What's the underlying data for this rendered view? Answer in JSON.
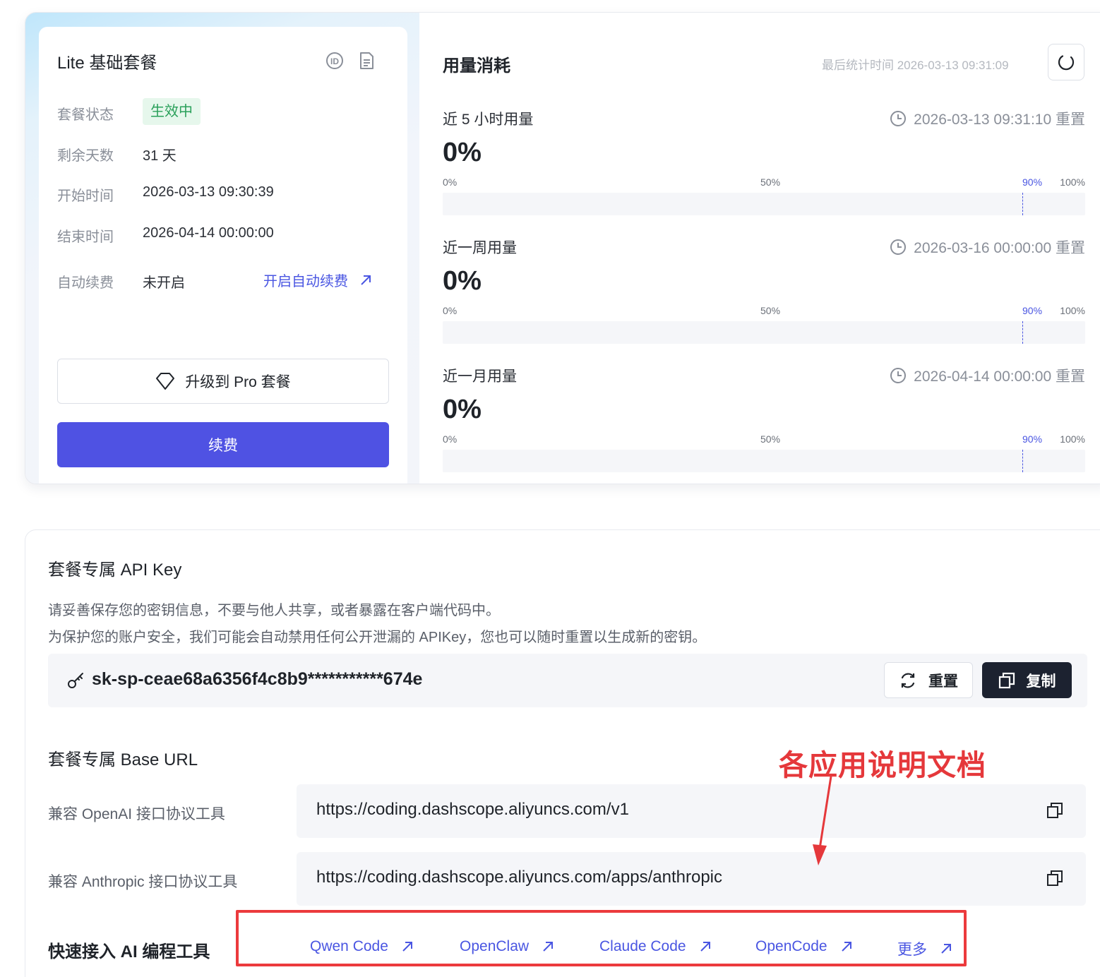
{
  "plan": {
    "title": "Lite 基础套餐",
    "rows": {
      "status_label": "套餐状态",
      "status_value": "生效中",
      "days_label": "剩余天数",
      "days_value": "31 天",
      "start_label": "开始时间",
      "start_value": "2026-03-13 09:30:39",
      "end_label": "结束时间",
      "end_value": "2026-04-14 00:00:00",
      "autorenew_label": "自动续费",
      "autorenew_value": "未开启",
      "autorenew_link": "开启自动续费"
    },
    "upgrade_label": "升级到 Pro 套餐",
    "renew_label": "续费"
  },
  "usage": {
    "title": "用量消耗",
    "last_stat": "最后统计时间 2026-03-13 09:31:09",
    "tick_labels": [
      "0%",
      "50%",
      "90%",
      "100%"
    ],
    "blocks": [
      {
        "label": "近 5 小时用量",
        "reset": "2026-03-13 09:31:10 重置",
        "percent": "0%",
        "value": 0
      },
      {
        "label": "近一周用量",
        "reset": "2026-03-16 00:00:00 重置",
        "percent": "0%",
        "value": 0
      },
      {
        "label": "近一月用量",
        "reset": "2026-04-14 00:00:00 重置",
        "percent": "0%",
        "value": 0
      }
    ]
  },
  "api_key": {
    "title": "套餐专属 API Key",
    "desc1": "请妥善保存您的密钥信息，不要与他人共享，或者暴露在客户端代码中。",
    "desc2": "为保护您的账户安全，我们可能会自动禁用任何公开泄漏的 APIKey，您也可以随时重置以生成新的密钥。",
    "key": "sk-sp-ceae68a6356f4c8b9***********674e",
    "reset_label": "重置",
    "copy_label": "复制"
  },
  "base_url": {
    "title": "套餐专属 Base URL",
    "openai_label": "兼容 OpenAI 接口协议工具",
    "openai_url": "https://coding.dashscope.aliyuncs.com/v1",
    "anthropic_label": "兼容 Anthropic 接口协议工具",
    "anthropic_url": "https://coding.dashscope.aliyuncs.com/apps/anthropic"
  },
  "tools": {
    "title": "快速接入 AI 编程工具",
    "links": [
      "Qwen Code",
      "OpenClaw",
      "Claude Code",
      "OpenCode",
      "更多"
    ]
  },
  "annotation": {
    "text": "各应用说明文档",
    "color": "#e5383b"
  },
  "colors": {
    "primary": "#4f52e3",
    "success": "#2aa05a",
    "dark_button": "#1c2230"
  }
}
